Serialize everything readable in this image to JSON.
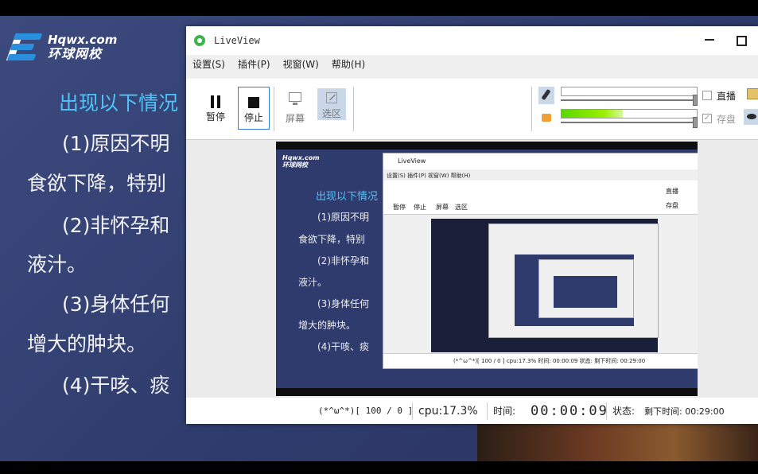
{
  "slide": {
    "logo_en": "Hqwx.com",
    "logo_cn": "环球网校",
    "lines": [
      "出现以下情况",
      "(1)原因不明",
      "食欲下降，特别",
      "(2)非怀孕和",
      "液汁。",
      "(3)身体任何",
      "增大的肿块。",
      "(4)干咳、痰"
    ]
  },
  "window": {
    "title": "LiveView",
    "menu": [
      "设置(S)",
      "插件(P)",
      "视窗(W)",
      "帮助(H)"
    ]
  },
  "toolbar": {
    "pause_label": "暂停",
    "stop_label": "停止",
    "screen_label": "屏幕",
    "region_label": "选区",
    "live_label": "直播",
    "save_label": "存盘",
    "mic_level": 0.0,
    "speaker_level": 0.45,
    "live_checked": false,
    "save_checked": true
  },
  "nested": {
    "title": "LiveView",
    "menu": "设置(S)  插件(P)  视窗(W)  帮助(H)",
    "pause": "暂停",
    "stop": "停止",
    "screen": "屏幕",
    "region": "选区",
    "live": "直播",
    "save": "存盘",
    "status": "(*^ω^*)[ 100 / 0 ]   cpu:17.3%  时间:  00:00:09   状态:  剩下时间: 00:29:00"
  },
  "status": {
    "fps": "(*^ω^*)[ 100 / 0 ]",
    "cpu": "cpu:17.3%",
    "time_label": "时间:",
    "time": "00:00:09",
    "status_label": "状态:",
    "remaining": "剩下时间: 00:29:00"
  }
}
